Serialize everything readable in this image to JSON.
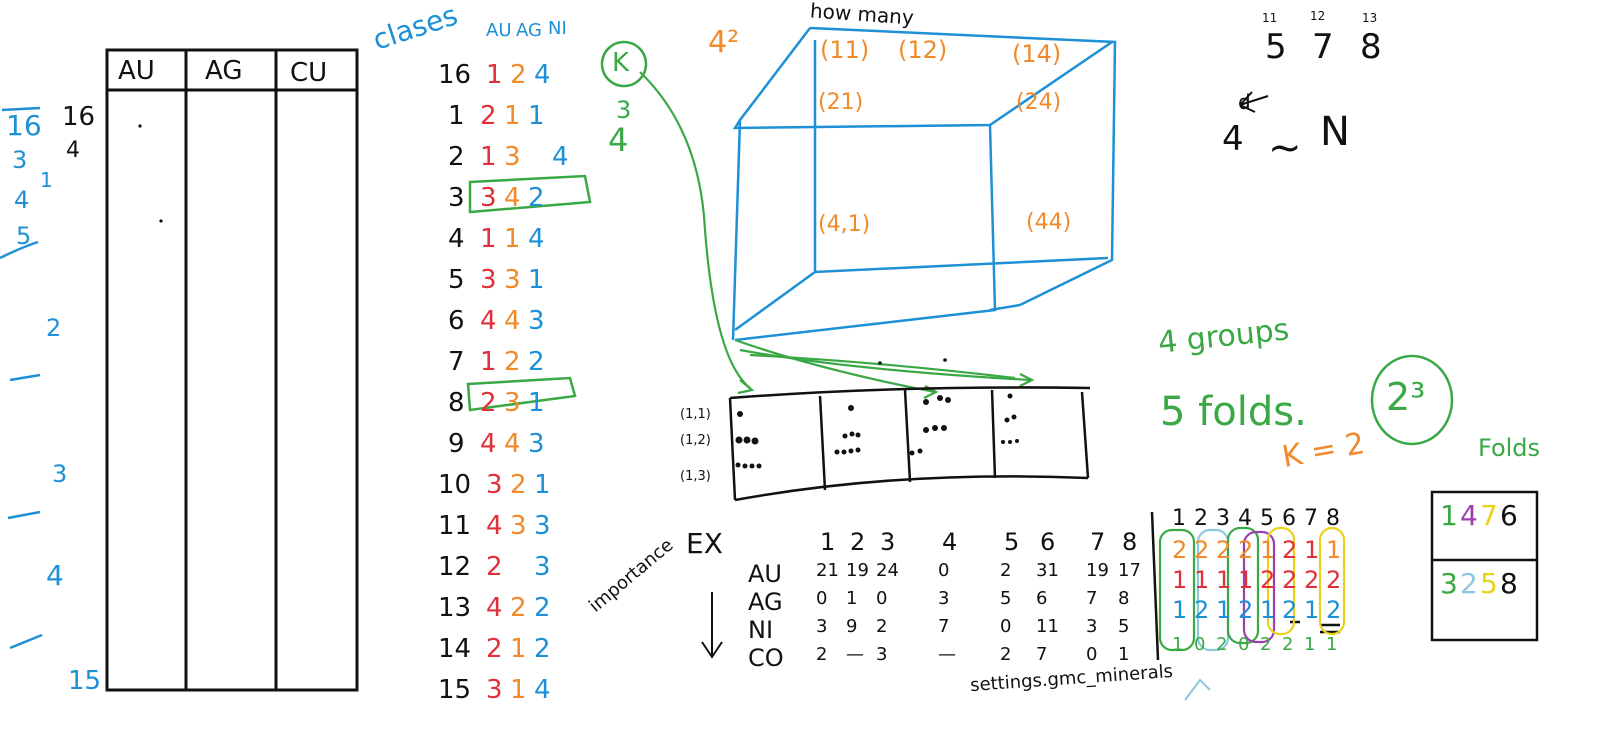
{
  "colors": {
    "blue": "#1e90d6",
    "green": "#3aa845",
    "orange": "#f08a2a",
    "red": "#e0303a",
    "purple": "#9b3fb0",
    "yellow": "#e8d21a",
    "lightblue": "#8cc8df",
    "black": "#111111"
  },
  "left_table": {
    "headers": [
      "AU",
      "AG",
      "CU"
    ]
  },
  "left_margin": {
    "top_values": [
      "16",
      "3",
      "4",
      "5"
    ],
    "black_values": [
      "16",
      "4"
    ],
    "small_one": "1",
    "mid_labels": [
      "2",
      "3",
      "4",
      "15"
    ]
  },
  "classes": {
    "title": "clases",
    "headers": [
      "AU",
      "AG",
      "NI"
    ],
    "rows": [
      {
        "n": "16",
        "v": [
          "1",
          "2",
          "4"
        ]
      },
      {
        "n": "1",
        "v": [
          "2",
          "1",
          "1"
        ]
      },
      {
        "n": "2",
        "v": [
          "1",
          "3",
          "",
          "4"
        ]
      },
      {
        "n": "3",
        "v": [
          "3",
          "4",
          "2"
        ]
      },
      {
        "n": "4",
        "v": [
          "1",
          "1",
          "4"
        ]
      },
      {
        "n": "5",
        "v": [
          "3",
          "3",
          "1"
        ]
      },
      {
        "n": "6",
        "v": [
          "4",
          "4",
          "3"
        ]
      },
      {
        "n": "7",
        "v": [
          "1",
          "2",
          "2"
        ]
      },
      {
        "n": "8",
        "v": [
          "2",
          "3",
          "1"
        ]
      },
      {
        "n": "9",
        "v": [
          "4",
          "4",
          "3"
        ]
      },
      {
        "n": "10",
        "v": [
          "3",
          "2",
          "1"
        ]
      },
      {
        "n": "11",
        "v": [
          "4",
          "3",
          "3"
        ]
      },
      {
        "n": "12",
        "v": [
          "2",
          "",
          "3"
        ]
      },
      {
        "n": "13",
        "v": [
          "4",
          "2",
          "2"
        ]
      },
      {
        "n": "14",
        "v": [
          "2",
          "1",
          "2"
        ]
      },
      {
        "n": "15",
        "v": [
          "3",
          "1",
          "4"
        ]
      }
    ],
    "side_note": [
      "3",
      "4"
    ]
  },
  "k_circle": "K",
  "cube": {
    "power": "4²",
    "label": "how many",
    "cells": [
      "(11)",
      "(12)",
      "(14)",
      "(21)",
      "(24)",
      "(4,1)",
      "(44)"
    ]
  },
  "bins": {
    "rows": [
      "(1,1)",
      "(1,2)",
      "(1,3)"
    ]
  },
  "top_right": {
    "small": [
      "11",
      "12",
      "13"
    ],
    "big": [
      "5",
      "7",
      "8"
    ],
    "formula_left": "4",
    "formula_d": "d",
    "formula_right": "N",
    "formula_tilde": "~"
  },
  "notes": {
    "groups": "4 groups",
    "folds": "5 folds.",
    "k_eq": "K = 2",
    "power": "2³",
    "folds_label": "Folds"
  },
  "ex_table": {
    "label": "EX",
    "cols": [
      "1",
      "2",
      "3",
      "4",
      "5",
      "6",
      "7",
      "8"
    ],
    "rows": [
      {
        "name": "AU",
        "v": [
          "21",
          "19",
          "24",
          "0",
          "2",
          "31",
          "19",
          "17"
        ]
      },
      {
        "name": "AG",
        "v": [
          "0",
          "1",
          "0",
          "3",
          "5",
          "6",
          "7",
          "8"
        ]
      },
      {
        "name": "NI",
        "v": [
          "3",
          "9",
          "2",
          "7",
          "0",
          "11",
          "3",
          "5"
        ]
      },
      {
        "name": "CO",
        "v": [
          "2",
          "—",
          "3",
          "—",
          "2",
          "7",
          "0",
          "1"
        ]
      }
    ],
    "importance": "importance",
    "settings": "settings.gmc_minerals"
  },
  "fold_grid": {
    "cols": [
      "1",
      "2",
      "3",
      "4",
      "5",
      "6",
      "7",
      "8"
    ],
    "row1": [
      "2",
      "2",
      "2",
      "2",
      "1",
      "2",
      "1",
      "1"
    ],
    "row2": [
      "1",
      "1",
      "1",
      "1",
      "2",
      "2",
      "2",
      "2"
    ],
    "row3": [
      "1",
      "2",
      "1",
      "2",
      "1",
      "2",
      "1",
      "2"
    ],
    "row4": [
      "1",
      "0",
      "2",
      "0",
      "2",
      "2",
      "1",
      "1"
    ]
  },
  "folds_box": {
    "top": [
      "1",
      "4",
      "7",
      "6"
    ],
    "bottom": [
      "3",
      "2",
      "5",
      "8"
    ]
  }
}
